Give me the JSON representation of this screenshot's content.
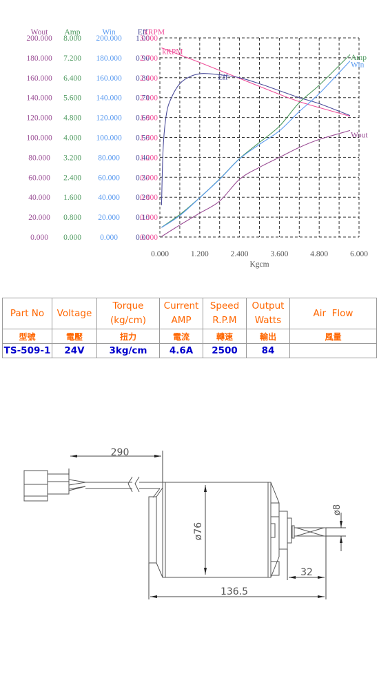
{
  "chart_data": {
    "type": "line",
    "title": "",
    "xlabel": "Kgcm",
    "x_ticks": [
      "0.000",
      "1.200",
      "2.400",
      "3.600",
      "4.800",
      "6.000"
    ],
    "xlim": [
      0,
      6
    ],
    "grid": true,
    "axes": [
      {
        "name": "Wout",
        "color": "#9b4f96",
        "ylim": [
          0,
          200
        ],
        "ticks": [
          "0.000",
          "20.000",
          "40.000",
          "60.000",
          "80.000",
          "100.000",
          "120.000",
          "140.000",
          "160.000",
          "180.000",
          "200.000"
        ]
      },
      {
        "name": "Amp",
        "color": "#4e9a5f",
        "ylim": [
          0,
          8
        ],
        "ticks": [
          "0.000",
          "0.800",
          "1.600",
          "2.400",
          "3.200",
          "4.000",
          "4.800",
          "5.600",
          "6.400",
          "7.200",
          "8.000"
        ]
      },
      {
        "name": "Win",
        "color": "#5b9bf0",
        "ylim": [
          0,
          200
        ],
        "ticks": [
          "0.000",
          "20.000",
          "40.000",
          "60.000",
          "80.000",
          "100.000",
          "120.000",
          "140.000",
          "160.000",
          "180.000",
          "200.000"
        ]
      },
      {
        "name": "Eff",
        "color": "#4b4c9a",
        "ylim": [
          0,
          1
        ],
        "ticks": [
          "0.00",
          "0.10",
          "0.20",
          "0.30",
          "0.40",
          "0.50",
          "0.60",
          "0.70",
          "0.80",
          "0.90",
          "1.00"
        ]
      },
      {
        "name": "kRPM",
        "color": "#f0509a",
        "ylim": [
          0,
          3
        ],
        "ticks": [
          "0.000",
          "0.300",
          "0.600",
          "0.900",
          "1.200",
          "1.500",
          "1.800",
          "2.100",
          "2.400",
          "2.700",
          "3.000"
        ]
      }
    ],
    "series": [
      {
        "name": "kRPM",
        "label": "kRPM",
        "axis": "kRPM",
        "x": [
          0.05,
          1.2,
          2.4,
          3.6,
          4.2,
          4.8,
          5.73
        ],
        "y": [
          2.85,
          2.63,
          2.39,
          2.15,
          2.04,
          1.95,
          1.82
        ]
      },
      {
        "name": "Eff",
        "label": "Eff",
        "axis": "Eff",
        "x": [
          0.05,
          0.1,
          0.2,
          0.35,
          0.6,
          0.9,
          1.2,
          1.5,
          1.8,
          2.4,
          3.0,
          3.6,
          4.2,
          4.8,
          5.73
        ],
        "y": [
          0.16,
          0.45,
          0.62,
          0.7,
          0.77,
          0.805,
          0.82,
          0.82,
          0.815,
          0.8,
          0.77,
          0.735,
          0.7,
          0.67,
          0.61
        ]
      },
      {
        "name": "Amp",
        "label": "Amp",
        "axis": "Amp",
        "x": [
          0.05,
          0.6,
          1.2,
          1.8,
          2.4,
          3.0,
          3.6,
          4.2,
          4.8,
          5.73
        ],
        "y": [
          0.39,
          0.9,
          1.58,
          2.33,
          3.15,
          3.8,
          4.45,
          5.4,
          6.1,
          7.33
        ]
      },
      {
        "name": "Win",
        "label": "Win",
        "axis": "Win",
        "x": [
          0.05,
          0.6,
          1.2,
          1.8,
          2.4,
          3.0,
          3.6,
          4.2,
          4.8,
          5.73
        ],
        "y": [
          9.5,
          21.5,
          39.4,
          58,
          78.5,
          93,
          106.6,
          126,
          144,
          176.8
        ]
      },
      {
        "name": "Wout",
        "label": "Wout",
        "axis": "Wout",
        "x": [
          0.05,
          0.6,
          1.2,
          1.8,
          2.4,
          3.0,
          3.6,
          4.2,
          4.8,
          5.73
        ],
        "y": [
          0.5,
          12,
          24,
          36,
          58,
          70,
          80,
          90,
          98,
          107
        ]
      }
    ]
  },
  "table": {
    "headers": [
      "Part No",
      "Voltage",
      "Torque\n(kg/cm)",
      "Current\nAMP",
      "Speed\nR.P.M",
      "Output\nWatts",
      "Air  Flow"
    ],
    "headers_cn": [
      "型號",
      "電壓",
      "扭力",
      "電流",
      "轉速",
      "輸出",
      "風量"
    ],
    "values": [
      "TS-509-1",
      "24V",
      "3kg/cm",
      "4.6A",
      "2500",
      "84",
      ""
    ]
  },
  "drawing": {
    "dim_cable_length": "290",
    "dim_body_diameter": "ø76",
    "dim_shaft_diameter": "ø8",
    "dim_shaft_length": "32",
    "dim_total_length": "136.5"
  }
}
